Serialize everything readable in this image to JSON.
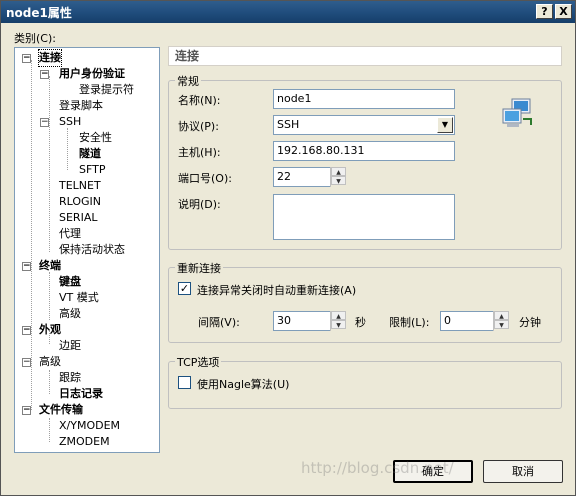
{
  "window": {
    "title": "node1属性",
    "help_label": "?",
    "close_label": "X"
  },
  "category_label": "类别(C):",
  "tree": {
    "items": [
      {
        "label": "连接"
      },
      {
        "label": "用户身份验证"
      },
      {
        "label": "登录提示符"
      },
      {
        "label": "登录脚本"
      },
      {
        "label": "SSH"
      },
      {
        "label": "安全性"
      },
      {
        "label": "隧道"
      },
      {
        "label": "SFTP"
      },
      {
        "label": "TELNET"
      },
      {
        "label": "RLOGIN"
      },
      {
        "label": "SERIAL"
      },
      {
        "label": "代理"
      },
      {
        "label": "保持活动状态"
      },
      {
        "label": "终端"
      },
      {
        "label": "键盘"
      },
      {
        "label": "VT 模式"
      },
      {
        "label": "高级"
      },
      {
        "label": "外观"
      },
      {
        "label": "边距"
      },
      {
        "label": "高级"
      },
      {
        "label": "跟踪"
      },
      {
        "label": "日志记录"
      },
      {
        "label": "文件传输"
      },
      {
        "label": "X/YMODEM"
      },
      {
        "label": "ZMODEM"
      }
    ]
  },
  "panel": {
    "title": "连接",
    "general": {
      "legend": "常规",
      "name_label": "名称(N):",
      "name_value": "node1",
      "protocol_label": "协议(P):",
      "protocol_value": "SSH",
      "host_label": "主机(H):",
      "host_value": "192.168.80.131",
      "port_label": "端口号(O):",
      "port_value": "22",
      "desc_label": "说明(D):",
      "desc_value": ""
    },
    "reconnect": {
      "legend": "重新连接",
      "auto_label": "连接异常关闭时自动重新连接(A)",
      "auto_checked": true,
      "interval_label": "间隔(V):",
      "interval_value": "30",
      "seconds_label": "秒",
      "limit_label": "限制(L):",
      "limit_value": "0",
      "minutes_label": "分钟"
    },
    "tcp": {
      "legend": "TCP选项",
      "nagle_label": "使用Nagle算法(U)",
      "nagle_checked": false
    }
  },
  "buttons": {
    "ok": "确定",
    "cancel": "取消"
  },
  "watermark": "http://blog.csdn.net/"
}
